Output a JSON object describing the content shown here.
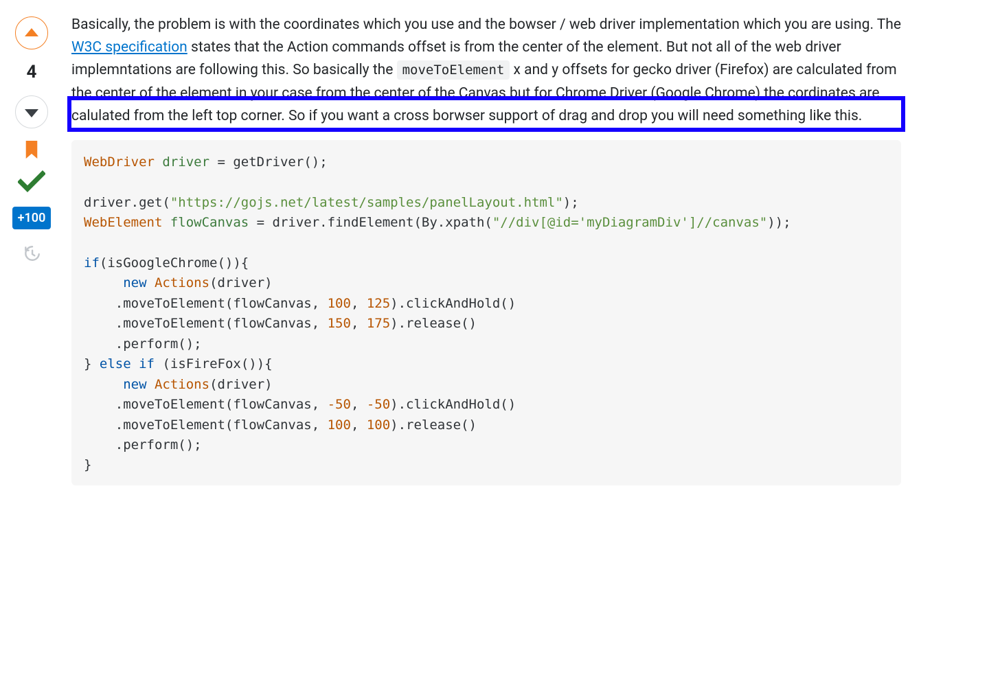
{
  "vote": {
    "score": "4",
    "bounty_label": "+100"
  },
  "answer": {
    "p1_before_link": "Basically, the problem is with the coordinates which you use and the bowser / web driver implementation which you are using. The ",
    "link_text": "W3C specification",
    "p1_after_link_a": " states that the Action commands offset is from the center of the element. But not all of the web driver implemntations are following this. So basically the ",
    "inline_code": "moveToElement",
    "p1_after_link_b": " x and y offsets for gecko driver (Firefox) are calculated from the center of the element in your case from the center of the Canvas but for Chrome Driver (Google Chrome) the cordinates are calulated from the left top corner. So if you want a cross borwser support of drag and drop you will need something like this."
  },
  "code": {
    "t_webdriver": "WebDriver",
    "t_driver": "driver",
    "t_eq_getdriver": " = getDriver();",
    "t_driverget": "driver.get(",
    "t_url": "\"https://gojs.net/latest/samples/panelLayout.html\"",
    "t_close1": ");",
    "t_webelement": "WebElement",
    "t_flowcanvas": "flowCanvas",
    "t_findel": " = driver.findElement(By.xpath(",
    "t_xpath": "\"//div[@id='myDiagramDiv']//canvas\"",
    "t_close2": "));",
    "t_if": "if",
    "t_isgoogle": "(isGoogleChrome()){",
    "t_new1": "new",
    "t_actions1": "Actions",
    "t_drv1": "(driver)",
    "t_move1a": "    .moveToElement(flowCanvas, ",
    "n_100a": "100",
    "t_c1": ", ",
    "n_125": "125",
    "t_clickhold": ").clickAndHold()",
    "t_move1b": "    .moveToElement(flowCanvas, ",
    "n_150": "150",
    "n_175": "175",
    "t_release": ").release()",
    "t_perform": "    .perform();",
    "t_else": "else",
    "t_elseif": " if",
    "t_isff": " (isFireFox()){",
    "t_new2": "new",
    "t_actions2": "Actions",
    "t_drv2": "(driver)",
    "t_move2a": "    .moveToElement(flowCanvas, ",
    "n_m50a": "-50",
    "n_m50b": "-50",
    "t_move2b": "    .moveToElement(flowCanvas, ",
    "n_100b": "100",
    "n_100c": "100",
    "t_closebrace": "}"
  }
}
